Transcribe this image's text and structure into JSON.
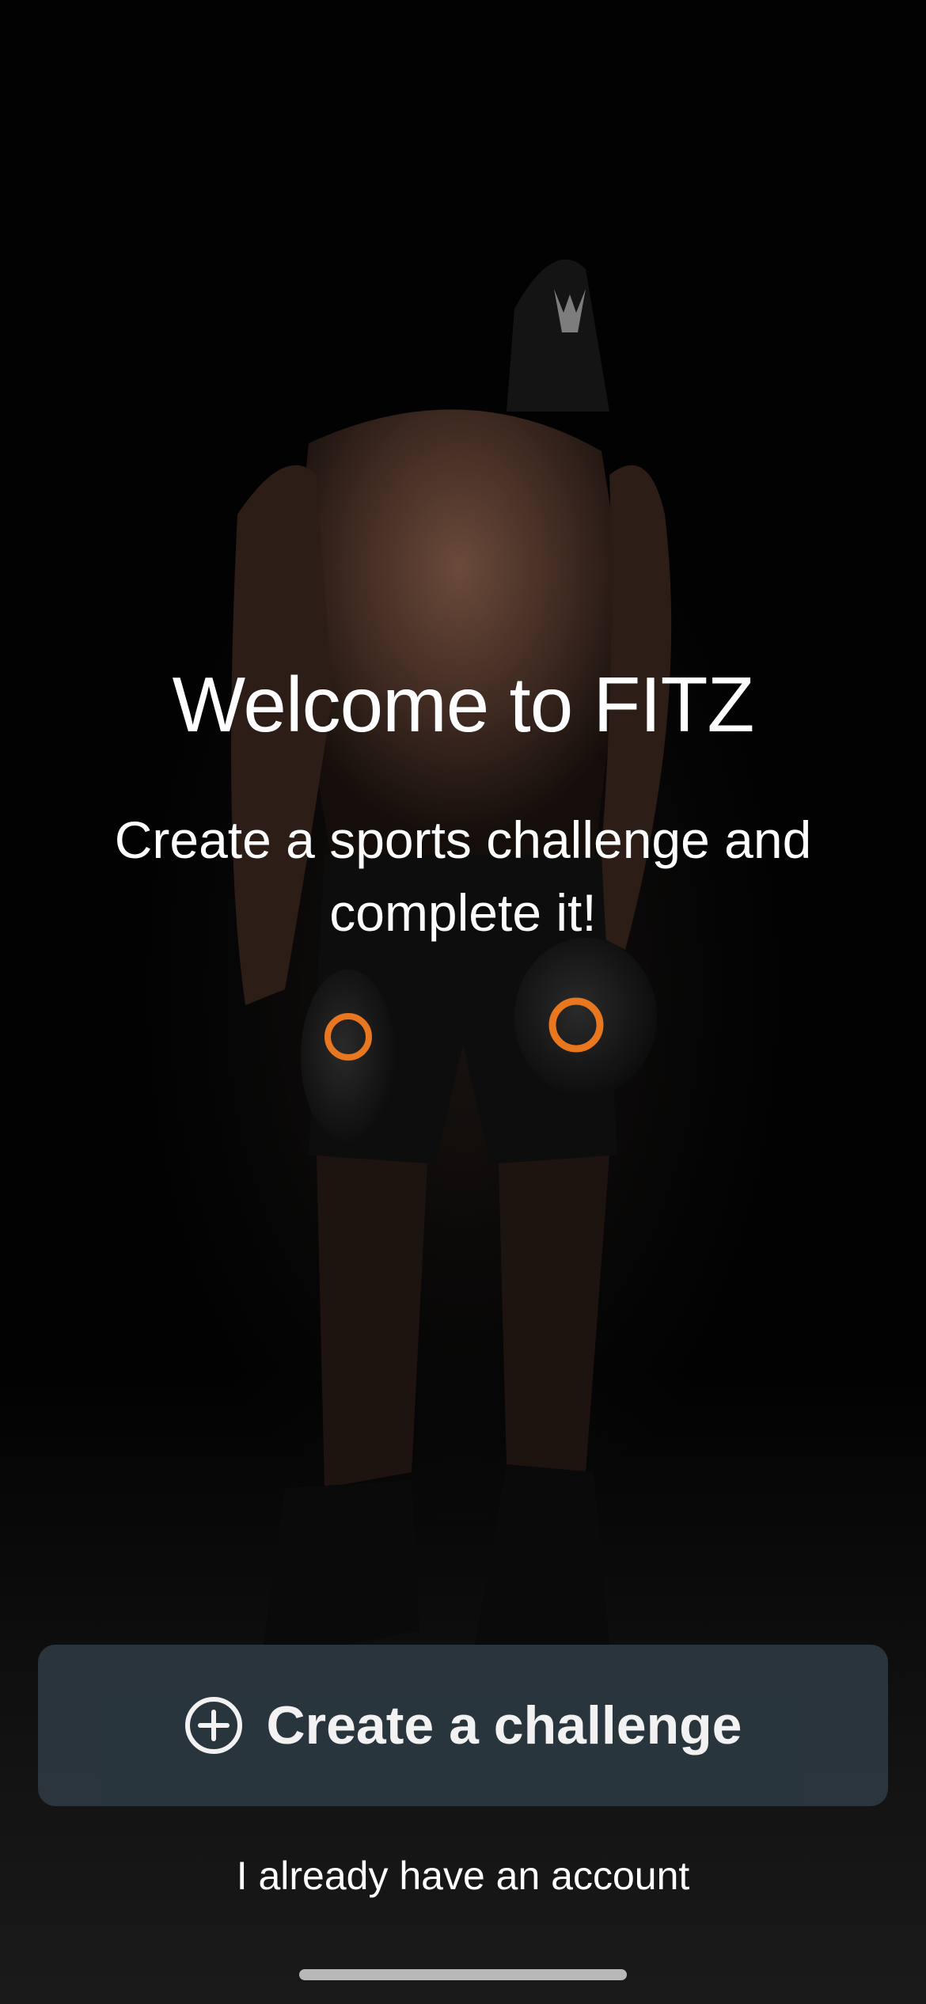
{
  "app": {
    "title": "Welcome to FITZ",
    "subtitle": "Create a sports challenge and complete it!"
  },
  "actions": {
    "create_challenge_label": "Create a challenge",
    "create_challenge_icon": "plus-circle-icon",
    "existing_account_label": "I already have an account"
  },
  "colors": {
    "background": "#050505",
    "button_background": "#2b3740",
    "text": "#ffffff",
    "accent_dumbbell_logo": "#e8771f"
  }
}
